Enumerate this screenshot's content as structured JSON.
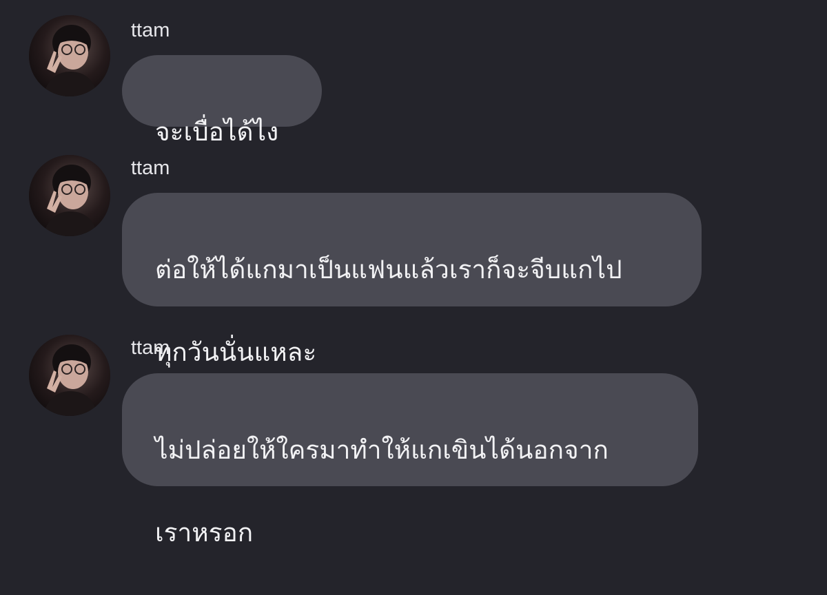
{
  "colors": {
    "background": "#24242b",
    "bubble": "#4a4a53",
    "text": "#f2f2f4",
    "sender_text": "#e6e6ea"
  },
  "messages": [
    {
      "sender": "ttam",
      "avatar_icon": "profile-photo",
      "lines": [
        "จะเบื่อได้ไง"
      ]
    },
    {
      "sender": "ttam",
      "avatar_icon": "profile-photo",
      "lines": [
        "ต่อให้ได้แกมาเป็นแฟนแล้วเราก็จะจีบแกไป",
        "ทุกวันนั่นแหละ"
      ]
    },
    {
      "sender": "ttam",
      "avatar_icon": "profile-photo",
      "lines": [
        "ไม่ปล่อยให้ใครมาทำให้แกเขินได้นอกจาก",
        "เราหรอก"
      ]
    }
  ]
}
